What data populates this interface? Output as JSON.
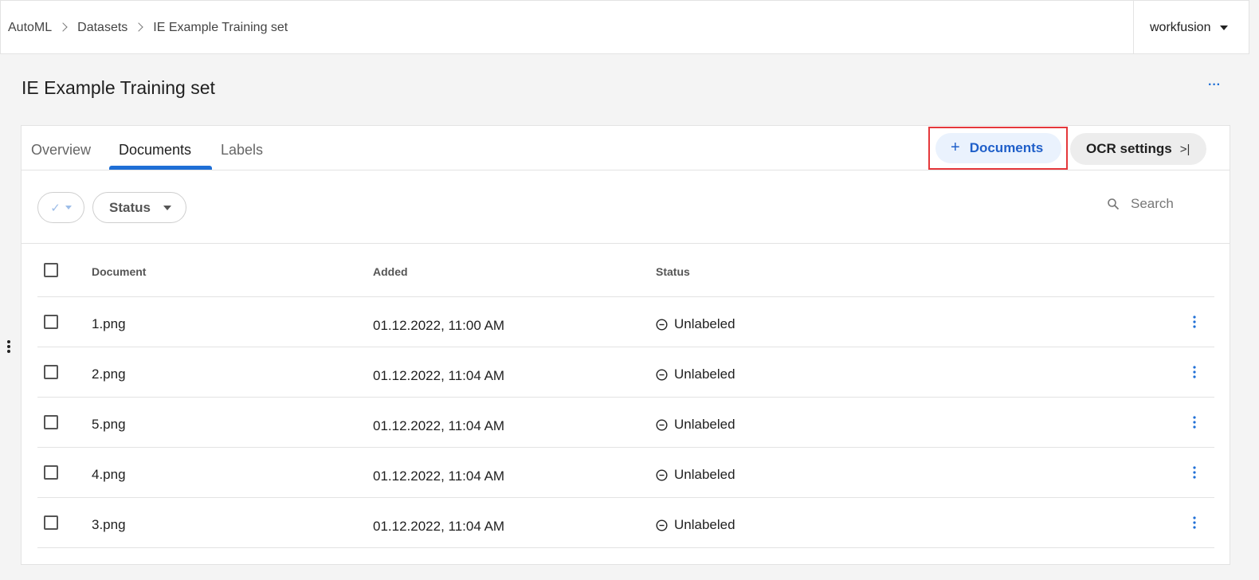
{
  "breadcrumb": [
    "AutoML",
    "Datasets",
    "IE Example Training set"
  ],
  "account": {
    "name": "workfusion"
  },
  "page": {
    "title": "IE Example Training set",
    "more_label": "···"
  },
  "tabs": [
    {
      "label": "Overview",
      "active": false
    },
    {
      "label": "Documents",
      "active": true
    },
    {
      "label": "Labels",
      "active": false
    }
  ],
  "actions": {
    "add_documents_label": "Documents",
    "add_documents_icon": "plus-icon",
    "ocr_settings_label": "OCR settings",
    "ocr_settings_icon": "chevron-to-end-icon"
  },
  "filters": {
    "check_icon": "check-icon",
    "status_label": "Status",
    "search_placeholder": "Search"
  },
  "table": {
    "columns": [
      "Document",
      "Added",
      "Status"
    ],
    "rows": [
      {
        "document": "1.png",
        "added": "01.12.2022, 11:00 AM",
        "status": "Unlabeled"
      },
      {
        "document": "2.png",
        "added": "01.12.2022, 11:04 AM",
        "status": "Unlabeled"
      },
      {
        "document": "5.png",
        "added": "01.12.2022, 11:04 AM",
        "status": "Unlabeled"
      },
      {
        "document": "4.png",
        "added": "01.12.2022, 11:04 AM",
        "status": "Unlabeled"
      },
      {
        "document": "3.png",
        "added": "01.12.2022, 11:04 AM",
        "status": "Unlabeled"
      }
    ]
  },
  "colors": {
    "accent": "#1f6fd6",
    "highlight_border": "#e5383b",
    "add_button_bg": "#eaf2fd"
  }
}
